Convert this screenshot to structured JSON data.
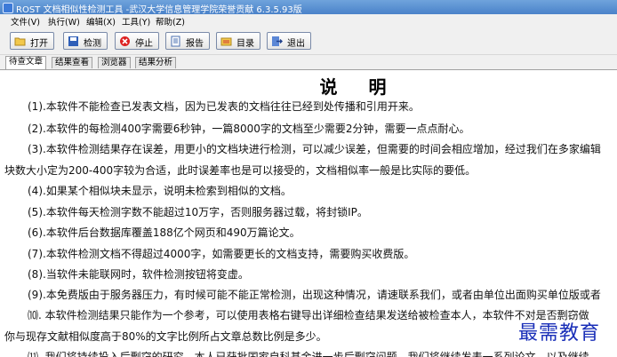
{
  "window": {
    "title": "ROST 文档相似性检测工具 -武汉大学信息管理学院荣誉贡献 6.3.5.93版"
  },
  "menu": [
    "文件(V)",
    "执行(W)",
    "编辑(X)",
    "工具(Y)",
    "帮助(Z)"
  ],
  "toolbar": {
    "open": "打开",
    "detect": "检测",
    "stop": "停止",
    "report": "报告",
    "catalog": "目录",
    "exit": "退出"
  },
  "tabs": [
    "待查文章",
    "结果查看",
    "浏览器",
    "结果分析"
  ],
  "document": {
    "heading": "说 明",
    "lines": [
      "(1).本软件不能检查已发表文档，因为已发表的文档往往已经到处传播和引用开来。",
      "(2).本软件的每检测400字需要6秒钟，一篇8000字的文档至少需要2分钟，需要一点点耐心。",
      "(3).本软件检测结果存在误差，用更小的文档块进行检测，可以减少误差，但需要的时间会相应增加，经过我们在多家编辑",
      "块数大小定为200-400字较为合适，此时误差率也是可以接受的，文档相似率一般是比实际的要低。",
      "(4).如果某个相似块未显示，说明未检索到相似的文档。",
      "(5).本软件每天检测字数不能超过10万字，否则服务器过载，将封锁IP。",
      "(6).本软件后台数据库覆盖188亿个网页和490万篇论文。",
      "(7).本软件检测文档不得超过4000字，如需要更长的文档支持，需要购买收费版。",
      "(8).当软件未能联网时，软件检测按钮将变虚。",
      "(9).本免费版由于服务器压力，有时候可能不能正常检测，出现这种情况，请速联系我们，或者由单位出面购买单位版或者",
      "⑽. 本软件检测结果只能作为一个参考，可以使用表格右键导出详细检查结果发送给被检查本人，本软件不对是否剽窃做",
      "你与现存文献相似度高于80%的文字比例所占文章总数比例是多少。",
      "⑾. 我们将持续投入后剽窃的研究，本人已获批国家自科基金进一步后剽窃问题，我们将继续发表一系列论文，以及继续"
    ]
  },
  "watermark": "最需教育"
}
